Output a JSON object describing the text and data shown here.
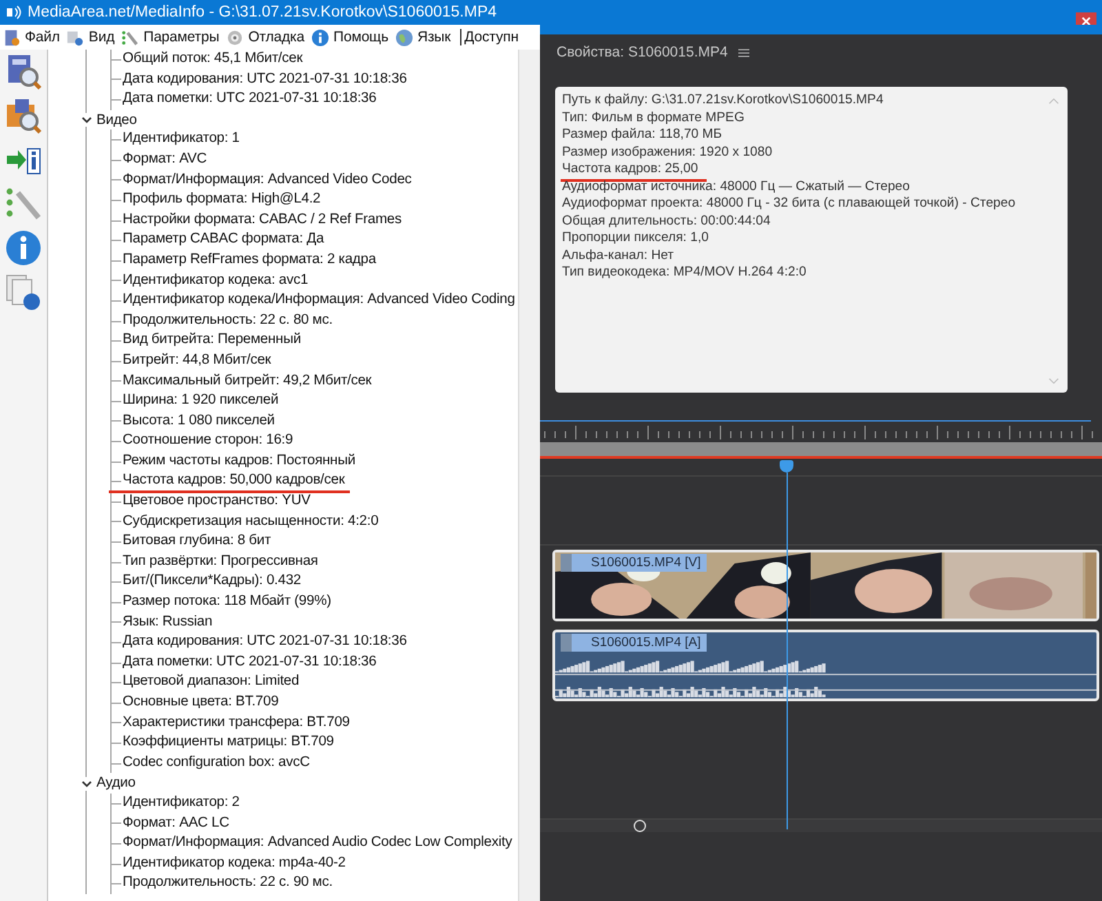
{
  "window": {
    "title": "MediaArea.net/MediaInfo - G:\\31.07.21sv.Korotkov\\S1060015.MP4"
  },
  "menu": [
    {
      "label": "Файл"
    },
    {
      "label": "Вид"
    },
    {
      "label": "Параметры"
    },
    {
      "label": "Отладка"
    },
    {
      "label": "Помощь"
    },
    {
      "label": "Язык"
    },
    {
      "label": "Доступн"
    }
  ],
  "tree": [
    {
      "children": [
        {
          "text": "Общий поток: 45,1 Мбит/сек",
          "annotated": false
        },
        {
          "text": "Дата кодирования: UTC 2021-07-31 10:18:36",
          "annotated": false
        },
        {
          "text": "Дата пометки: UTC 2021-07-31 10:18:36",
          "annotated": false
        }
      ]
    },
    {
      "label": "Видео",
      "expanded": true,
      "children": [
        {
          "text": "Идентификатор: 1",
          "annotated": false
        },
        {
          "text": "Формат: AVC",
          "annotated": false
        },
        {
          "text": "Формат/Информация: Advanced Video Codec",
          "annotated": false
        },
        {
          "text": "Профиль формата: High@L4.2",
          "annotated": false
        },
        {
          "text": "Настройки формата: CABAC / 2 Ref Frames",
          "annotated": false
        },
        {
          "text": "Параметр CABAC формата: Да",
          "annotated": false
        },
        {
          "text": "Параметр RefFrames формата: 2 кадра",
          "annotated": false
        },
        {
          "text": "Идентификатор кодека: avc1",
          "annotated": false
        },
        {
          "text": "Идентификатор кодека/Информация: Advanced Video Coding",
          "annotated": false
        },
        {
          "text": "Продолжительность: 22 с. 80 мс.",
          "annotated": false
        },
        {
          "text": "Вид битрейта: Переменный",
          "annotated": false
        },
        {
          "text": "Битрейт: 44,8 Мбит/сек",
          "annotated": false
        },
        {
          "text": "Максимальный битрейт: 49,2 Мбит/сек",
          "annotated": false
        },
        {
          "text": "Ширина: 1 920 пикселей",
          "annotated": false
        },
        {
          "text": "Высота: 1 080 пикселей",
          "annotated": false
        },
        {
          "text": "Соотношение сторон: 16:9",
          "annotated": false
        },
        {
          "text": "Режим частоты кадров: Постоянный",
          "annotated": false
        },
        {
          "text": "Частота кадров: 50,000 кадров/сек",
          "annotated": true
        },
        {
          "text": "Цветовое пространство: YUV",
          "annotated": false
        },
        {
          "text": "Субдискретизация насыщенности: 4:2:0",
          "annotated": false
        },
        {
          "text": "Битовая глубина: 8 бит",
          "annotated": false
        },
        {
          "text": "Тип развёртки: Прогрессивная",
          "annotated": false
        },
        {
          "text": "Бит/(Пиксели*Кадры): 0.432",
          "annotated": false
        },
        {
          "text": "Размер потока: 118 Мбайт (99%)",
          "annotated": false
        },
        {
          "text": "Язык: Russian",
          "annotated": false
        },
        {
          "text": "Дата кодирования: UTC 2021-07-31 10:18:36",
          "annotated": false
        },
        {
          "text": "Дата пометки: UTC 2021-07-31 10:18:36",
          "annotated": false
        },
        {
          "text": "Цветовой диапазон: Limited",
          "annotated": false
        },
        {
          "text": "Основные цвета: BT.709",
          "annotated": false
        },
        {
          "text": "Характеристики трансфера: BT.709",
          "annotated": false
        },
        {
          "text": "Коэффициенты матрицы: BT.709",
          "annotated": false
        },
        {
          "text": "Codec configuration box: avcC",
          "annotated": false
        }
      ]
    },
    {
      "label": "Аудио",
      "expanded": true,
      "children": [
        {
          "text": "Идентификатор: 2",
          "annotated": false
        },
        {
          "text": "Формат: AAC LC",
          "annotated": false
        },
        {
          "text": "Формат/Информация: Advanced Audio Codec Low Complexity",
          "annotated": false
        },
        {
          "text": "Идентификатор кодека: mp4a-40-2",
          "annotated": false
        },
        {
          "text": "Продолжительность: 22 с. 90 мс.",
          "annotated": false
        }
      ]
    }
  ],
  "properties": {
    "title": "Свойства: S1060015.MP4",
    "lines": [
      {
        "text": "Путь к файлу: G:\\31.07.21sv.Korotkov\\S1060015.MP4",
        "annotated": false
      },
      {
        "text": "Тип: Фильм в формате MPEG",
        "annotated": false
      },
      {
        "text": "Размер файла: 118,70 МБ",
        "annotated": false
      },
      {
        "text": "Размер изображения: 1920 x 1080",
        "annotated": false
      },
      {
        "text": "Частота кадров: 25,00",
        "annotated": true
      },
      {
        "text": "Аудиоформат источника: 48000 Гц — Сжатый — Стерео",
        "annotated": false
      },
      {
        "text": "Аудиоформат проекта: 48000 Гц - 32 бита (с плавающей точкой) - Стерео",
        "annotated": false
      },
      {
        "text": "Общая длительность: 00:00:44:04",
        "annotated": false
      },
      {
        "text": "Пропорции пикселя: 1,0",
        "annotated": false
      },
      {
        "text": "Альфа-канал: Нет",
        "annotated": false
      },
      {
        "text": "Тип видеокодека: MP4/MOV H.264 4:2:0",
        "annotated": false
      }
    ]
  },
  "timeline": {
    "clips": [
      {
        "kind": "video",
        "label": "S1060015.MP4 [V]"
      },
      {
        "kind": "audio",
        "label": "S1060015.MP4 [A]"
      }
    ]
  }
}
